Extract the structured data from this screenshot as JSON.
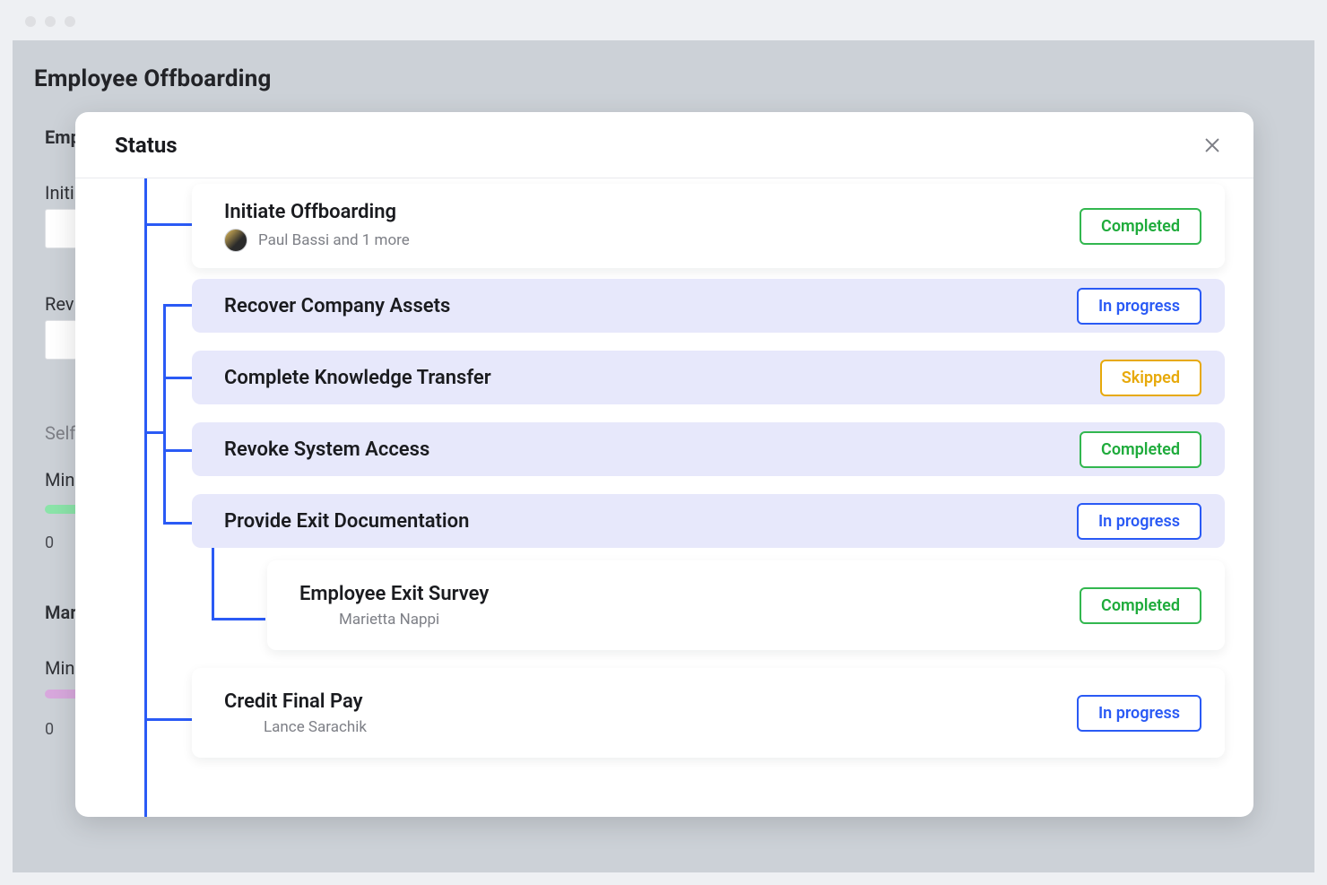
{
  "background": {
    "page_title": "Employee Offboarding",
    "labels": {
      "emp": "Emp",
      "initi": "Initi",
      "rev": "Rev",
      "self": "Self",
      "min1": "Min",
      "mar": "Mar",
      "min2": "Min",
      "zero1": "0",
      "zero2": "0"
    }
  },
  "modal": {
    "title": "Status"
  },
  "status_badges": {
    "completed": "Completed",
    "in_progress": "In progress",
    "skipped": "Skipped"
  },
  "steps": [
    {
      "title": "Initiate Offboarding",
      "assignee": "Paul Bassi and 1 more",
      "has_avatar": true,
      "status": "completed"
    },
    {
      "title": "Recover Company Assets",
      "status": "in_progress",
      "purple": true
    },
    {
      "title": "Complete Knowledge Transfer",
      "status": "skipped",
      "purple": true
    },
    {
      "title": "Revoke System Access",
      "status": "completed",
      "purple": true
    },
    {
      "title": "Provide Exit Documentation",
      "status": "in_progress",
      "purple": true
    },
    {
      "title": "Employee Exit Survey",
      "assignee": "Marietta Nappi",
      "assignee_indent": true,
      "status": "completed",
      "sub": true
    },
    {
      "title": "Credit Final Pay",
      "assignee": "Lance Sarachik",
      "assignee_indent": true,
      "status": "in_progress"
    }
  ]
}
